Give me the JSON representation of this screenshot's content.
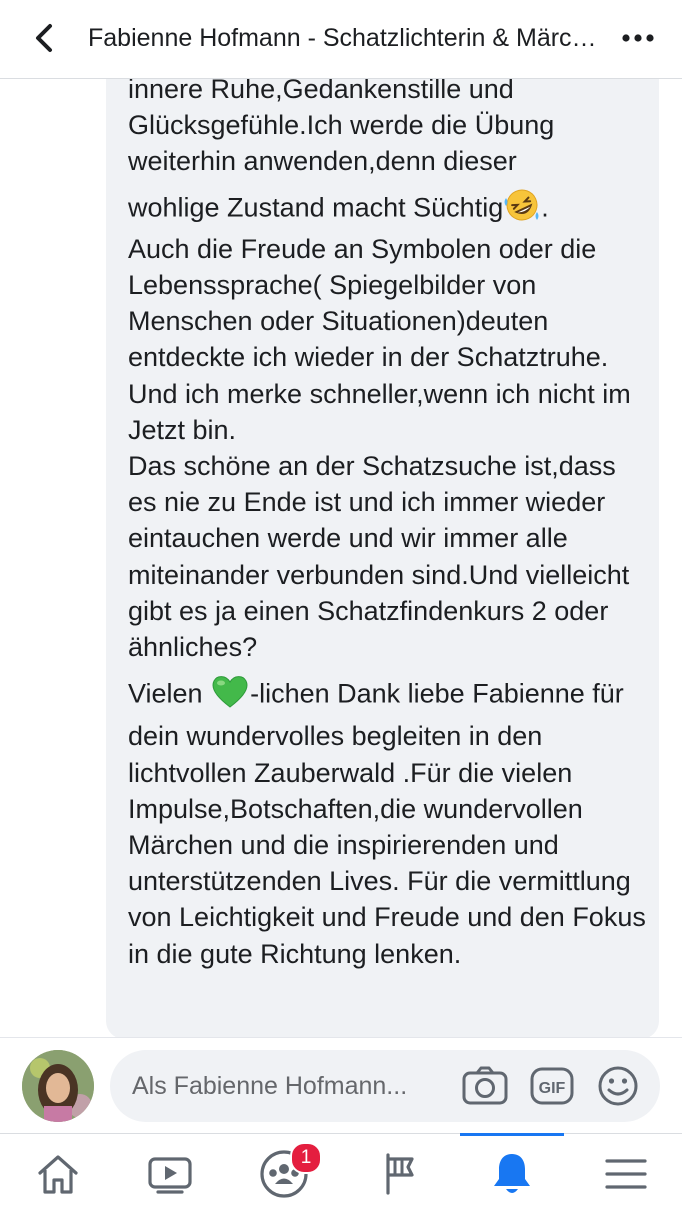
{
  "header": {
    "title": "Fabienne Hofmann - Schatzlichterin & Märchenerzählerin"
  },
  "comment": {
    "paragraphs": [
      "innere Ruhe,Gedankenstille und Glücksgefühle.Ich werde die Übung weiterhin anwenden,denn dieser",
      "wohlige Zustand macht Süchtig",
      ".",
      "Auch die Freude an Symbolen oder die Lebenssprache( Spiegelbilder von Menschen oder Situationen)deuten entdeckte ich wieder in der Schatztruhe.",
      "Und ich merke schneller,wenn ich nicht im Jetzt bin.",
      "Das schöne an der Schatzsuche ist,dass es nie zu Ende ist und ich immer wieder eintauchen werde und wir immer alle miteinander verbunden sind.Und vielleicht gibt es ja einen Schatzfindenkurs 2 oder ähnliches?",
      "Vielen ",
      "-lichen Dank liebe Fabienne für dein wundervolles begleiten in den lichtvollen  Zauberwald .Für die vielen Impulse,Botschaften,die wundervollen Märchen und die inspirierenden und unterstützenden  Lives. Für die vermittlung von Leichtigkeit und Freude und den Fokus in die gute Richtung lenken."
    ],
    "emoji_laughing": "rolling-on-floor-laughing-emoji",
    "emoji_heart": "green-heart-emoji"
  },
  "composer": {
    "placeholder": "Als Fabienne Hofmann...",
    "gif_label": "GIF"
  },
  "tabbar": {
    "groups_badge": "1"
  },
  "colors": {
    "accent": "#1877f2",
    "bubble": "#f0f2f5",
    "badge": "#e41e3f",
    "heart": "#3fb94f"
  }
}
